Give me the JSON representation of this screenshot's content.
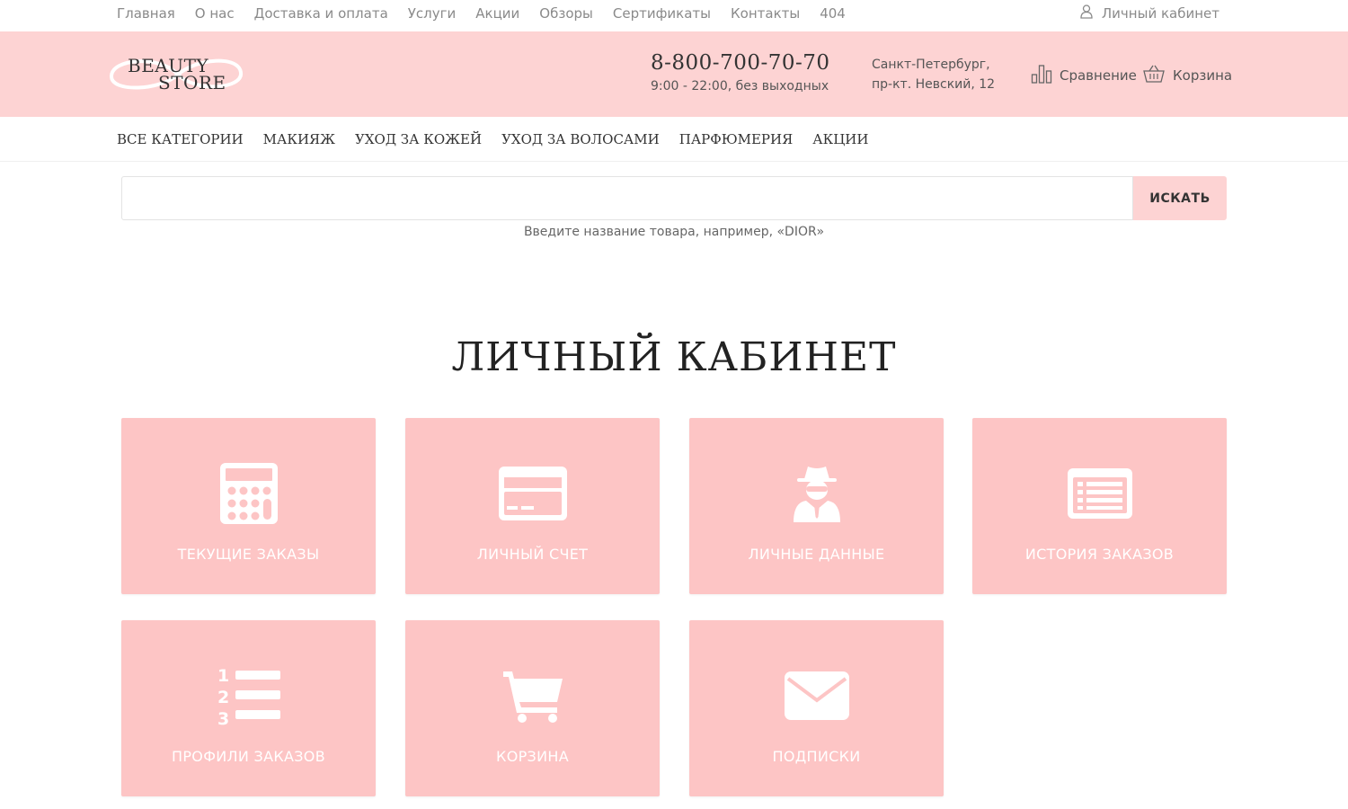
{
  "topnav": {
    "items": [
      "Главная",
      "О нас",
      "Доставка и оплата",
      "Услуги",
      "Акции",
      "Обзоры",
      "Сертификаты",
      "Контакты",
      "404"
    ],
    "account": "Личный кабинет"
  },
  "header": {
    "logo_line1": "BEAUTY",
    "logo_line2": "STORE",
    "phone": "8-800-700-70-70",
    "hours": "9:00 - 22:00, без выходных",
    "address_line1": "Санкт-Петербург,",
    "address_line2": "пр-кт. Невский, 12",
    "compare": "Сравнение",
    "cart": "Корзина"
  },
  "mainnav": {
    "items": [
      "ВСЕ КАТЕГОРИИ",
      "МАКИЯЖ",
      "УХОД ЗА КОЖЕЙ",
      "УХОД ЗА ВОЛОСАМИ",
      "ПАРФЮМЕРИЯ",
      "АКЦИИ"
    ]
  },
  "search": {
    "value": "",
    "button": "ИСКАТЬ",
    "hint": "Введите название товара, например, «DIOR»"
  },
  "page": {
    "title": "ЛИЧНЫЙ КАБИНЕТ"
  },
  "tiles": [
    {
      "label": "ТЕКУЩИЕ ЗАКАЗЫ",
      "icon": "calculator-icon"
    },
    {
      "label": "ЛИЧНЫЙ СЧЕТ",
      "icon": "credit-card-icon"
    },
    {
      "label": "ЛИЧНЫЕ ДАННЫЕ",
      "icon": "user-secret-icon"
    },
    {
      "label": "ИСТОРИЯ ЗАКАЗОВ",
      "icon": "list-alt-icon"
    },
    {
      "label": "ПРОФИЛИ ЗАКАЗОВ",
      "icon": "list-ol-icon"
    },
    {
      "label": "КОРЗИНА",
      "icon": "shopping-cart-icon"
    },
    {
      "label": "ПОДПИСКИ",
      "icon": "envelope-icon"
    }
  ],
  "colors": {
    "header_bg": "#fdd3d3",
    "tile_bg": "#fdc5c5",
    "muted_text": "#8a8a8a"
  }
}
